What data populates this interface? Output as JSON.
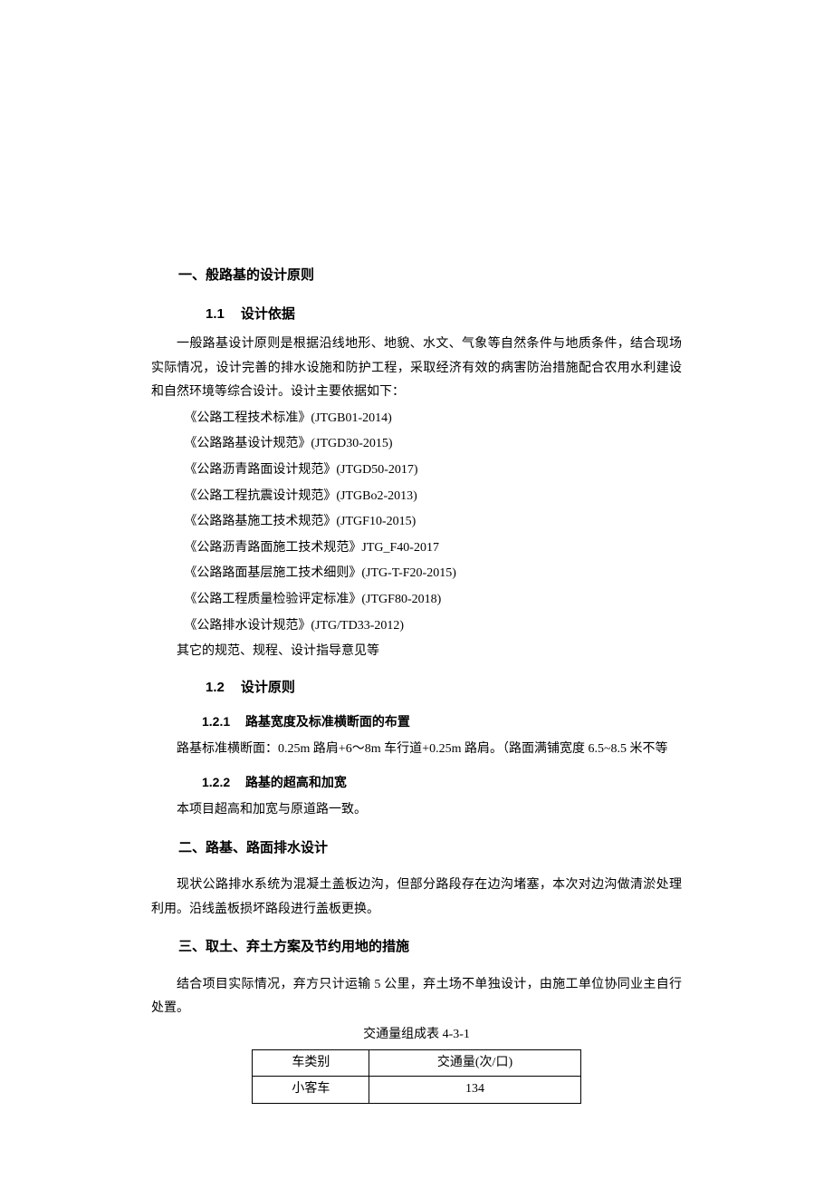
{
  "section1": {
    "title": "一、般路基的设计原则",
    "s11": {
      "title_num": "1.1",
      "title_txt": "设计依据",
      "intro": "一般路基设计原则是根据沿线地形、地貌、水文、气象等自然条件与地质条件，结合现场实际情况，设计完善的排水设施和防护工程，采取经济有效的病害防治措施配合农用水利建设和自然环境等综合设计。设计主要依据如下：",
      "refs": [
        "《公路工程技术标准》(JTGB01-2014)",
        "《公路路基设计规范》(JTGD30-2015)",
        "《公路沥青路面设计规范》(JTGD50-2017)",
        "《公路工程抗震设计规范》(JTGBo2-2013)",
        "《公路路基施工技术规范》(JTGF10-2015)",
        "《公路沥青路面施工技术规范》JTG_F40-2017",
        "《公路路面基层施工技术细则》(JTG-T-F20-2015)",
        "《公路工程质量检验评定标准》(JTGF80-2018)",
        "《公路排水设计规范》(JTG/TD33-2012)"
      ],
      "tail": "其它的规范、规程、设计指导意见等"
    },
    "s12": {
      "title_num": "1.2",
      "title_txt": "设计原则",
      "s121": {
        "title_num": "1.2.1",
        "title_txt": "路基宽度及标准横断面的布置",
        "body": "路基标准横断面：0.25m 路肩+6～8m 车行道+0.25m 路肩。（路面满铺宽度 6.5~8.5 米不等"
      },
      "s122": {
        "title_num": "1.2.2",
        "title_txt": "路基的超高和加宽",
        "body": "本项目超高和加宽与原道路一致。"
      }
    }
  },
  "section2": {
    "title": "二、路基、路面排水设计",
    "body": "现状公路排水系统为混凝土盖板边沟，但部分路段存在边沟堵塞，本次对边沟做清淤处理利用。沿线盖板损坏路段进行盖板更换。"
  },
  "section3": {
    "title": "三、取土、弃土方案及节约用地的措施",
    "body": "结合项目实际情况，弃方只计运输 5 公里，弃土场不单独设计，由施工单位协同业主自行处置。",
    "table_caption": "交通量组成表 4-3-1",
    "table": {
      "header": [
        "车类别",
        "交通量(次/口)"
      ],
      "rows": [
        [
          "小客车",
          "134"
        ]
      ]
    }
  }
}
